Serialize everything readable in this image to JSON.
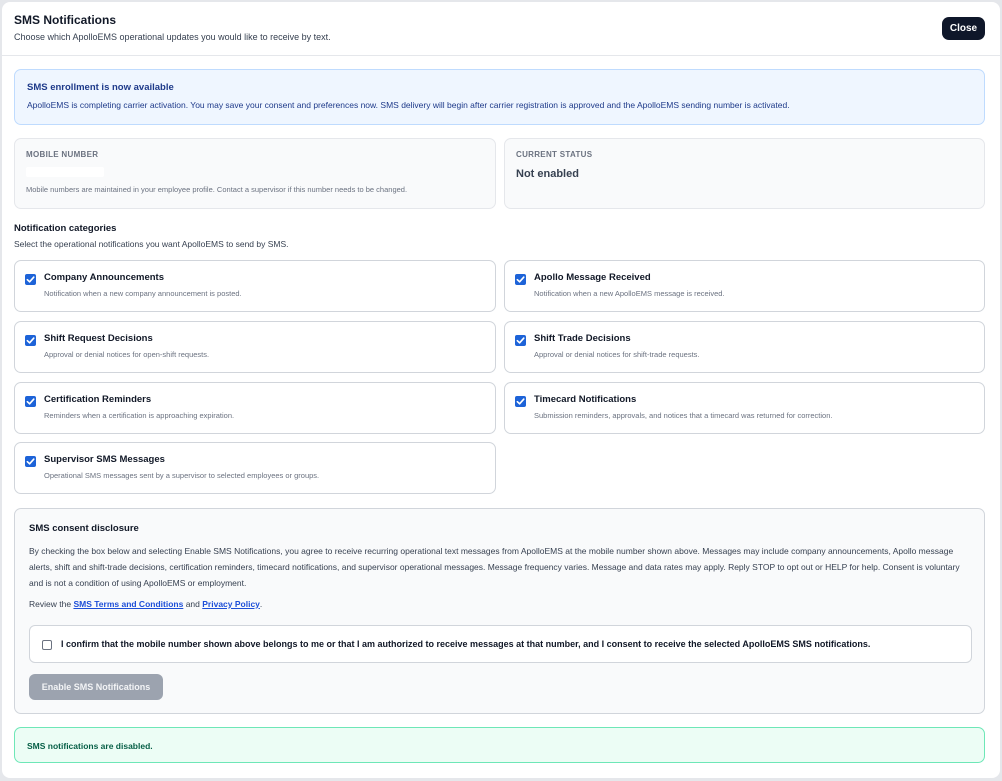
{
  "header": {
    "title": "SMS Notifications",
    "subtitle": "Choose which ApolloEMS operational updates you would like to receive by text.",
    "close_label": "Close"
  },
  "info": {
    "title": "SMS enrollment is now available",
    "body": "ApolloEMS is completing carrier activation. You may save your consent and preferences now. SMS delivery will begin after carrier registration is approved and the ApolloEMS sending number is activated."
  },
  "mobile": {
    "label": "MOBILE NUMBER",
    "note": "Mobile numbers are maintained in your employee profile. Contact a supervisor if this number needs to be changed."
  },
  "status": {
    "label": "CURRENT STATUS",
    "value": "Not enabled"
  },
  "categories": {
    "title": "Notification categories",
    "description": "Select the operational notifications you want ApolloEMS to send by SMS.",
    "items": [
      {
        "title": "Company Announcements",
        "desc": "Notification when a new company announcement is posted.",
        "checked": true
      },
      {
        "title": "Apollo Message Received",
        "desc": "Notification when a new ApolloEMS message is received.",
        "checked": true
      },
      {
        "title": "Shift Request Decisions",
        "desc": "Approval or denial notices for open-shift requests.",
        "checked": true
      },
      {
        "title": "Shift Trade Decisions",
        "desc": "Approval or denial notices for shift-trade requests.",
        "checked": true
      },
      {
        "title": "Certification Reminders",
        "desc": "Reminders when a certification is approaching expiration.",
        "checked": true
      },
      {
        "title": "Timecard Notifications",
        "desc": "Submission reminders, approvals, and notices that a timecard was returned for correction.",
        "checked": true
      },
      {
        "title": "Supervisor SMS Messages",
        "desc": "Operational SMS messages sent by a supervisor to selected employees or groups.",
        "checked": true
      }
    ]
  },
  "consent": {
    "title": "SMS consent disclosure",
    "body": "By checking the box below and selecting Enable SMS Notifications, you agree to receive recurring operational text messages from ApolloEMS at the mobile number shown above. Messages may include company announcements, Apollo message alerts, shift and shift-trade decisions, certification reminders, timecard notifications, and supervisor operational messages. Message frequency varies. Message and data rates may apply. Reply STOP to opt out or HELP for help. Consent is voluntary and is not a condition of using ApolloEMS or employment.",
    "review_prefix": "Review the",
    "terms_link": "SMS Terms and Conditions",
    "and": "and",
    "privacy_link": "Privacy Policy",
    "period": ".",
    "confirm_text": "I confirm that the mobile number shown above belongs to me or that I am authorized to receive messages at that number, and I consent to receive the selected ApolloEMS SMS notifications.",
    "confirm_checked": false,
    "enable_label": "Enable SMS Notifications"
  },
  "footer": {
    "status": "SMS notifications are disabled."
  }
}
